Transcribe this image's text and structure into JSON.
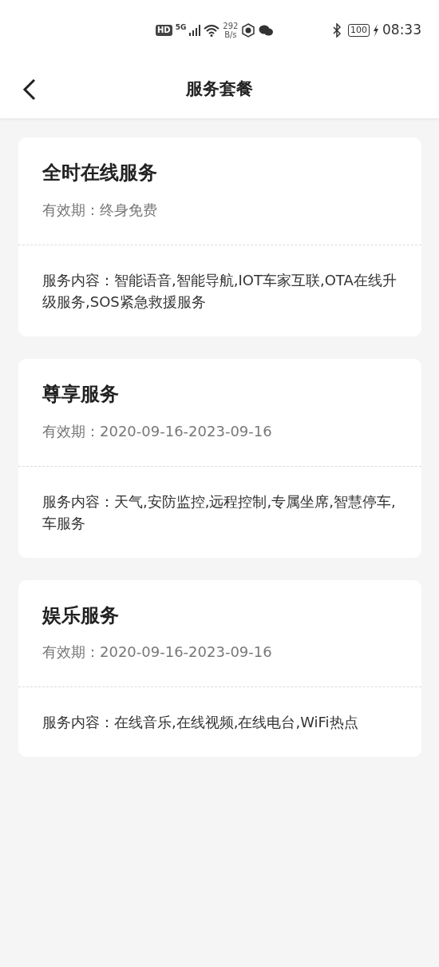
{
  "status_bar": {
    "hd": "HD",
    "network": "5G",
    "speed_value": "292",
    "speed_unit": "B/s",
    "battery": "100",
    "time": "08:33"
  },
  "header": {
    "title": "服务套餐"
  },
  "packages": [
    {
      "name": "全时在线服务",
      "validity": "有效期：终身免费",
      "content": "服务内容：智能语音,智能导航,IOT车家互联,OTA在线升级服务,SOS紧急救援服务"
    },
    {
      "name": "尊享服务",
      "validity": "有效期：2020-09-16-2023-09-16",
      "content": "服务内容：天气,安防监控,远程控制,专属坐席,智慧停车,车服务"
    },
    {
      "name": "娱乐服务",
      "validity": "有效期：2020-09-16-2023-09-16",
      "content": "服务内容：在线音乐,在线视频,在线电台,WiFi热点"
    }
  ]
}
